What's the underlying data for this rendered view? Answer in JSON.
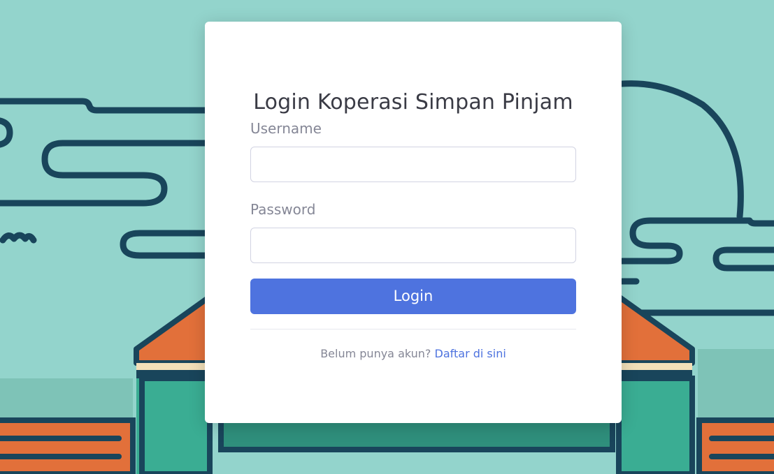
{
  "login": {
    "title": "Login Koperasi Simpan Pinjam",
    "username_label": "Username",
    "username_value": "",
    "password_label": "Password",
    "password_value": "",
    "submit_label": "Login",
    "register_prompt": "Belum punya akun?",
    "register_link": "Daftar di sini"
  },
  "colors": {
    "background": "#93d4cc",
    "primary": "#4e73df",
    "label": "#858796",
    "title": "#3a3b45",
    "illustration_outline": "#19455b",
    "illustration_orange": "#e2703a",
    "illustration_green": "#3aad93"
  }
}
